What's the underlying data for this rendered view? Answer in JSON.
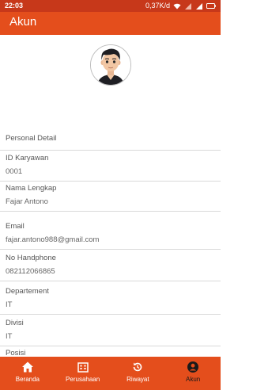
{
  "status_bar": {
    "time": "22:03",
    "network_speed": "0,37K/d"
  },
  "app_bar": {
    "title": "Akun"
  },
  "profile": {
    "section_title": "Personal Detail",
    "fields": [
      {
        "label": "ID Karyawan",
        "value": "0001"
      },
      {
        "label": "Nama Lengkap",
        "value": "Fajar Antono"
      },
      {
        "label": "Email",
        "value": "fajar.antono988@gmail.com"
      },
      {
        "label": "No Handphone",
        "value": "082112066865"
      },
      {
        "label": "Departement",
        "value": "IT"
      },
      {
        "label": "Divisi",
        "value": "IT"
      },
      {
        "label": "Posisi",
        "value": ""
      }
    ]
  },
  "bottom_nav": {
    "items": [
      {
        "label": "Beranda",
        "icon": "home-icon"
      },
      {
        "label": "Perusahaan",
        "icon": "building-icon"
      },
      {
        "label": "Riwayat",
        "icon": "history-icon"
      },
      {
        "label": "Akun",
        "icon": "account-icon",
        "active": true
      }
    ]
  },
  "colors": {
    "primary": "#e44e1c",
    "status_bar": "#c7381a",
    "active_nav_label": "#1a1a1a"
  }
}
